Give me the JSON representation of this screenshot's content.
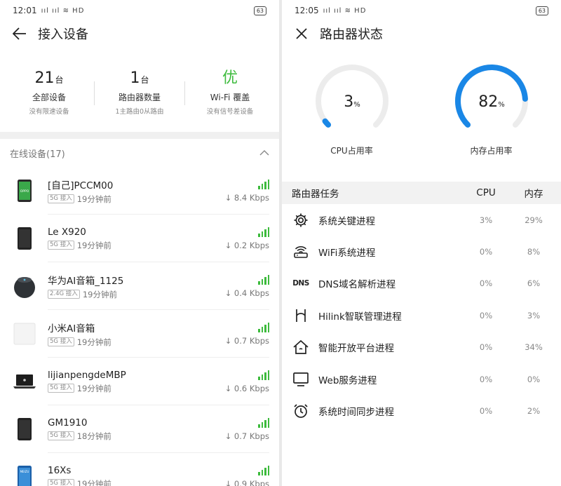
{
  "left": {
    "status": {
      "time": "12:01",
      "signal": "ııl ııl ≋ HD",
      "battery": "63"
    },
    "title": "接入设备",
    "summary": [
      {
        "value": "21",
        "unit": "台",
        "label": "全部设备",
        "sub": "没有限速设备"
      },
      {
        "value": "1",
        "unit": "台",
        "label": "路由器数量",
        "sub": "1主路由0从路由"
      },
      {
        "value": "优",
        "unit": "",
        "label": "Wi-Fi 覆盖",
        "sub": "没有信号差设备"
      }
    ],
    "section": "在线设备(17)",
    "devices": [
      {
        "name": "[自己]PCCM00",
        "badge": "5G 接入",
        "time": "19分钟前",
        "speed": "↓ 8.4 Kbps",
        "icon": "phone-oppo-icon"
      },
      {
        "name": "Le X920",
        "badge": "5G 接入",
        "time": "19分钟前",
        "speed": "↓ 0.2 Kbps",
        "icon": "phone-icon"
      },
      {
        "name": "华为AI音箱_1125",
        "badge": "2.4G 接入",
        "time": "19分钟前",
        "speed": "↓ 0.4 Kbps",
        "icon": "speaker-icon"
      },
      {
        "name": "小米AI音箱",
        "badge": "5G 接入",
        "time": "19分钟前",
        "speed": "↓ 0.7 Kbps",
        "icon": "speaker-box-icon"
      },
      {
        "name": "lijianpengdeMBP",
        "badge": "5G 接入",
        "time": "19分钟前",
        "speed": "↓ 0.6 Kbps",
        "icon": "laptop-icon"
      },
      {
        "name": "GM1910",
        "badge": "5G 接入",
        "time": "18分钟前",
        "speed": "↓ 0.7 Kbps",
        "icon": "phone-icon"
      },
      {
        "name": "16Xs",
        "badge": "5G 接入",
        "time": "19分钟前",
        "speed": "↓ 0.9 Kbps",
        "icon": "phone-meizu-icon"
      }
    ]
  },
  "right": {
    "status": {
      "time": "12:05",
      "signal": "ııl ııl ≋ HD",
      "battery": "63"
    },
    "title": "路由器状态",
    "gauges": [
      {
        "value": 3,
        "label": "CPU占用率",
        "unit": "%",
        "display": "3"
      },
      {
        "value": 82,
        "label": "内存占用率",
        "unit": "%",
        "display": "82"
      }
    ],
    "task_header": {
      "name": "路由器任务",
      "cpu": "CPU",
      "mem": "内存"
    },
    "tasks": [
      {
        "name": "系统关键进程",
        "cpu": "3%",
        "mem": "29%",
        "icon": "gear-icon"
      },
      {
        "name": "WiFi系统进程",
        "cpu": "0%",
        "mem": "8%",
        "icon": "router-icon"
      },
      {
        "name": "DNS域名解析进程",
        "cpu": "0%",
        "mem": "6%",
        "icon": "dns-icon",
        "icon_text": "DNS"
      },
      {
        "name": "Hilink智联管理进程",
        "cpu": "0%",
        "mem": "3%",
        "icon": "hilink-icon"
      },
      {
        "name": "智能开放平台进程",
        "cpu": "0%",
        "mem": "34%",
        "icon": "home-icon"
      },
      {
        "name": "Web服务进程",
        "cpu": "0%",
        "mem": "0%",
        "icon": "monitor-icon"
      },
      {
        "name": "系统时间同步进程",
        "cpu": "0%",
        "mem": "2%",
        "icon": "alarm-clock-icon"
      }
    ]
  },
  "colors": {
    "accent_blue": "#1a87e6",
    "good_green": "#3dbb3d",
    "track": "#ececec"
  }
}
